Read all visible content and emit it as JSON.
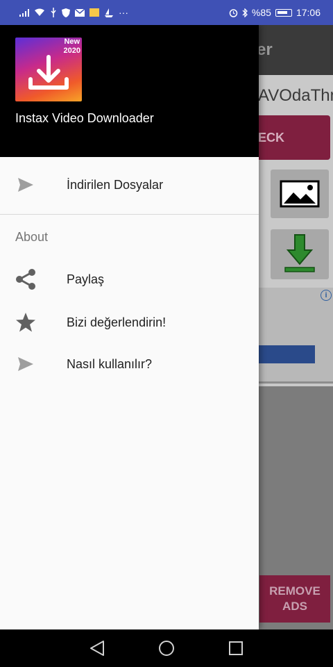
{
  "status_bar": {
    "battery_percent": "%85",
    "time": "17:06",
    "overflow": "···"
  },
  "background": {
    "toolbar_title_fragment": "er",
    "url_fragment": "AVOdaThn",
    "check_button_label": "ECK",
    "ad_info": "i",
    "remove_ads_label_line1": "REMOVE",
    "remove_ads_label_line2": "ADS"
  },
  "drawer": {
    "logo_badge_line1": "New",
    "logo_badge_line2": "2020",
    "app_name": "Instax Video Downloader",
    "items": [
      {
        "label": "İndirilen Dosyalar",
        "icon": "send-icon"
      }
    ],
    "section_title": "About",
    "about_items": [
      {
        "label": "Paylaş",
        "icon": "share-icon"
      },
      {
        "label": "Bizi değerlendirin!",
        "icon": "star-icon"
      },
      {
        "label": "Nasıl kullanılır?",
        "icon": "send-icon"
      }
    ]
  },
  "nav_bar": {
    "back": "back-icon",
    "home": "home-icon",
    "recents": "recents-icon"
  },
  "colors": {
    "status_bar": "#3F51B5",
    "drawer_header": "#000000",
    "drawer_bg": "#FAFAFA",
    "icon_gray": "#757575",
    "accent_pink": "#D81B60"
  }
}
